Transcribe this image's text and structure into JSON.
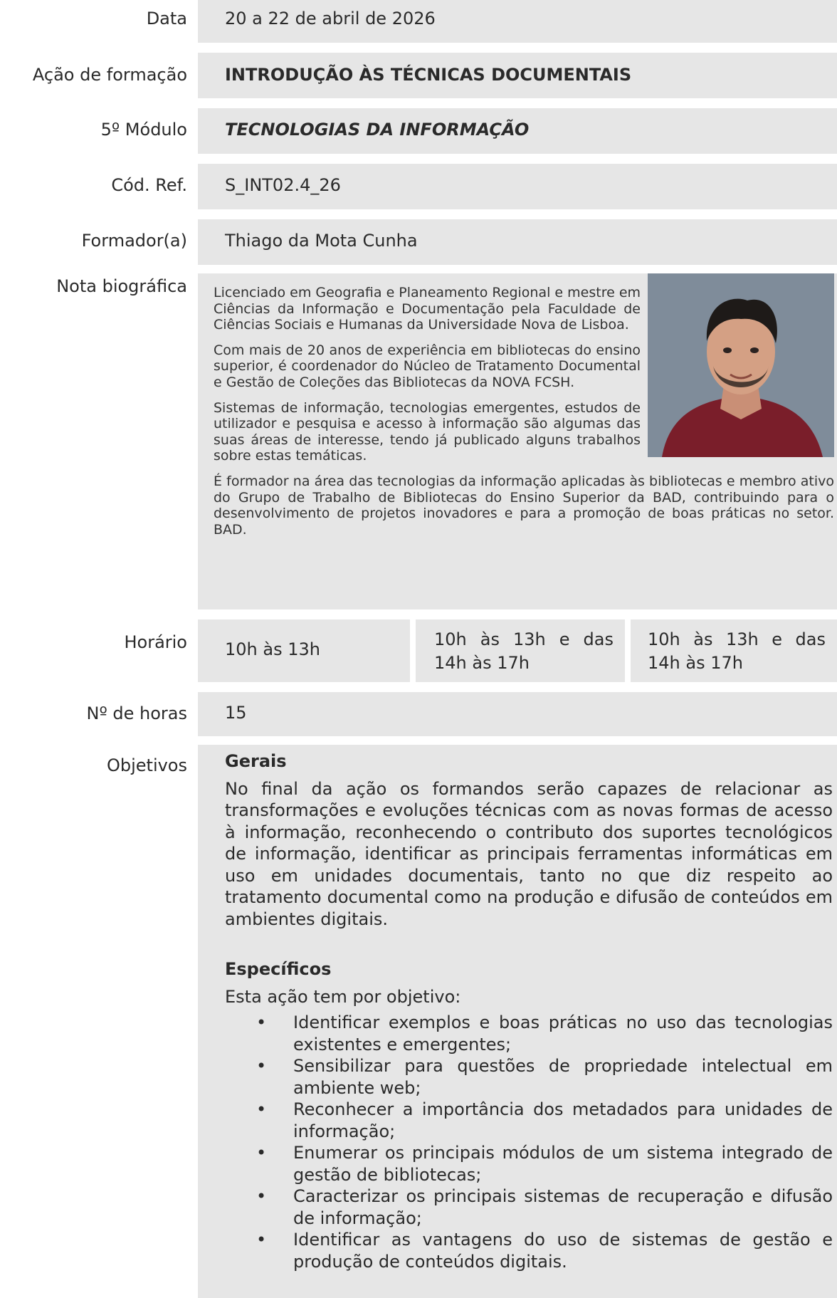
{
  "rows": {
    "data": {
      "label": "Data",
      "value": "20 a 22 de abril de 2026"
    },
    "acao": {
      "label": "Ação de formação",
      "value": "INTRODUÇÃO ÀS TÉCNICAS DOCUMENTAIS"
    },
    "modulo": {
      "label": "5º Módulo",
      "value": "TECNOLOGIAS DA INFORMAÇÃO"
    },
    "cod": {
      "label": "Cód. Ref.",
      "value": "S_INT02.4_26"
    },
    "formador": {
      "label": "Formador(a)",
      "value": "Thiago da Mota Cunha"
    },
    "nota": {
      "label": "Nota biográfica"
    },
    "horario": {
      "label": "Horário"
    },
    "horas": {
      "label": "Nº de horas",
      "value": "15"
    },
    "objetivos": {
      "label": "Objetivos"
    }
  },
  "bio": {
    "paragraphs": [
      "Licenciado em Geografia e Planeamento Regional e mestre em Ciências da Informação e Documentação pela Faculdade de Ciências Sociais e Humanas da Universidade Nova de Lisboa.",
      "Com mais de 20 anos de experiência em bibliotecas do ensino superior, é coordenador do Núcleo de Tratamento Documental e Gestão de Coleções das Bibliotecas da NOVA FCSH.",
      "Sistemas de informação, tecnologias emergentes, estudos de utilizador e pesquisa e acesso à informação são algumas das suas áreas de interesse, tendo já publicado alguns trabalhos sobre estas temáticas.",
      "É formador na área das tecnologias da informação aplicadas às bibliotecas e membro ativo do Grupo de Trabalho de Bibliotecas do Ensino Superior da BAD, contribuindo para o desenvolvimento de projetos inovadores e para a promoção de boas práticas no setor. BAD."
    ],
    "photo": "trainer-portrait"
  },
  "horario": [
    "10h às 13h",
    "10h às 13h e das 14h às 17h",
    "10h às 13h e das 14h às 17h"
  ],
  "objetivos": {
    "gerais_title": "Gerais",
    "gerais_text": "No final da ação os formandos serão capazes de relacionar as transformações e evoluções técnicas com as novas formas de acesso à informação, reconhecendo o contributo dos suportes tecnológicos de informação, identificar as principais ferramentas informáticas em uso em unidades documentais, tanto no que diz respeito ao tratamento documental como na produção e difusão de conteúdos em ambientes digitais.",
    "especificos_title": "Específicos",
    "especificos_intro": "Esta ação tem por objetivo:",
    "items": [
      "Identificar exemplos e boas práticas no uso das tecnologias existentes e emergentes;",
      "Sensibilizar para questões de propriedade intelectual em ambiente web;",
      "Reconhecer a importância dos metadados para unidades de informação;",
      "Enumerar os principais módulos de um sistema integrado de gestão de bibliotecas;",
      "Caracterizar os principais sistemas de recuperação e difusão de informação;",
      "Identificar as vantagens do uso de sistemas de gestão e produção de conteúdos digitais."
    ],
    "bullet": "•"
  }
}
